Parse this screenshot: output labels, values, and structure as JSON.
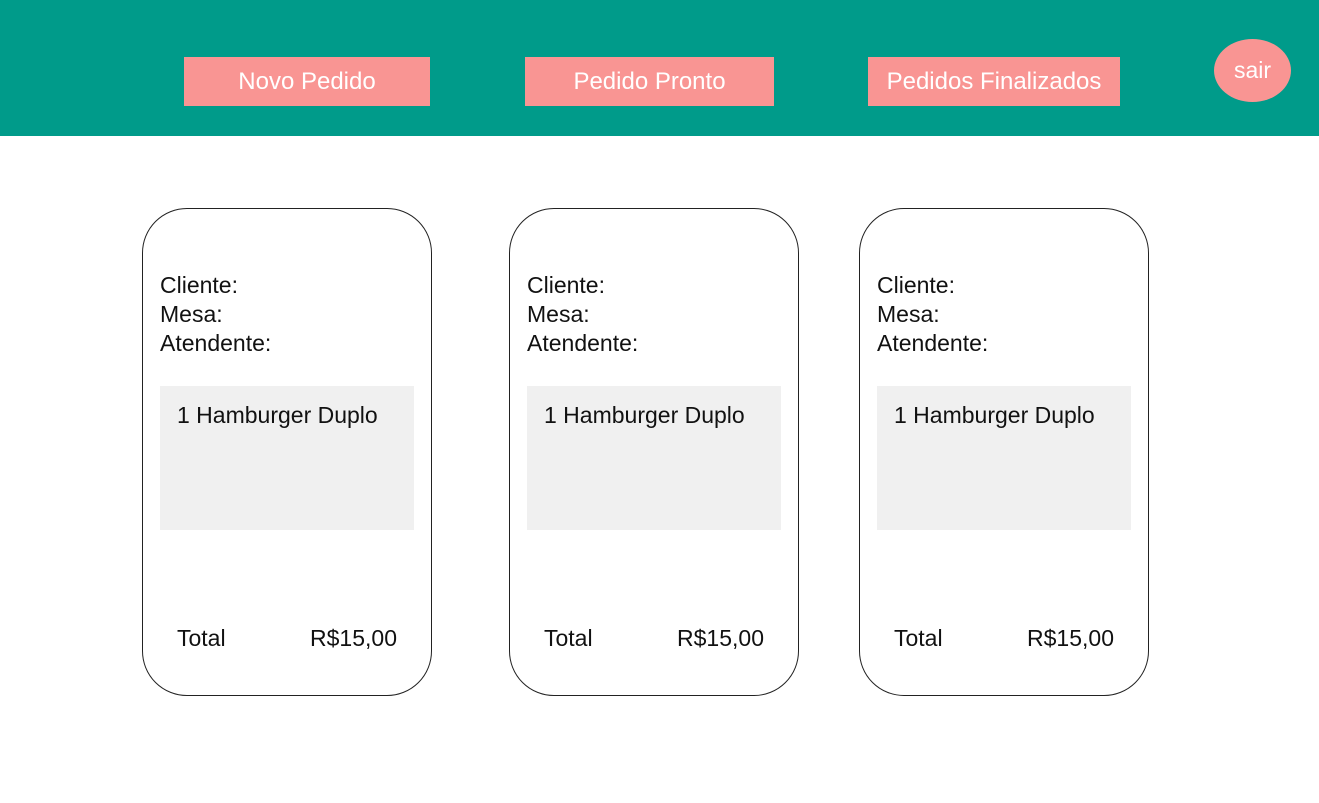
{
  "header": {
    "nav": [
      {
        "label": "Novo Pedido"
      },
      {
        "label": "Pedido Pronto"
      },
      {
        "label": "Pedidos Finalizados"
      }
    ],
    "logout_label": "sair"
  },
  "orders": [
    {
      "client_label": "Cliente:",
      "table_label": "Mesa:",
      "attendant_label": "Atendente:",
      "items": [
        "1 Hamburger Duplo"
      ],
      "total_label": "Total",
      "total_value": "R$15,00"
    },
    {
      "client_label": "Cliente:",
      "table_label": "Mesa:",
      "attendant_label": "Atendente:",
      "items": [
        "1 Hamburger Duplo"
      ],
      "total_label": "Total",
      "total_value": "R$15,00"
    },
    {
      "client_label": "Cliente:",
      "table_label": "Mesa:",
      "attendant_label": "Atendente:",
      "items": [
        "1 Hamburger Duplo"
      ],
      "total_label": "Total",
      "total_value": "R$15,00"
    }
  ],
  "colors": {
    "header_bg": "#009b8a",
    "button_bg": "#f99593",
    "item_area_bg": "#f0f0f0"
  }
}
